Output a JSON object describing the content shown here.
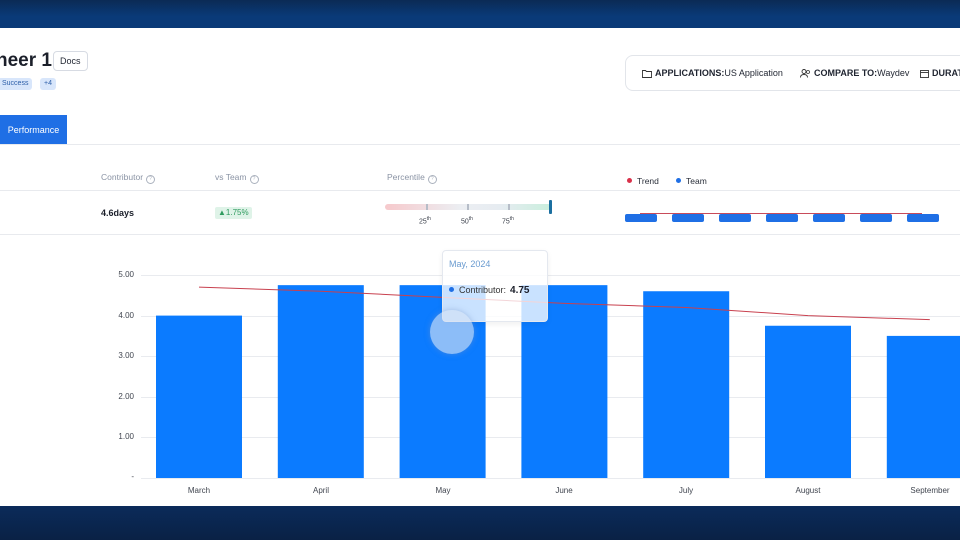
{
  "header": {
    "title": "neer 1",
    "docs_label": "Docs",
    "tags": [
      "Success",
      "+4"
    ]
  },
  "filters": {
    "applications_label": "APPLICATIONS:",
    "applications_value": "US Application",
    "compare_label": "COMPARE TO:",
    "compare_value": "Waydev",
    "duration_label": "DURATI"
  },
  "tabs": {
    "active": "Performance"
  },
  "metrics_table": {
    "headers": {
      "contributor": "Contributor",
      "vs_team": "vs Team",
      "percentile": "Percentile"
    },
    "legend": {
      "trend": "Trend",
      "team": "Team"
    },
    "row": {
      "contributor_value": "4.6days",
      "vs_team": "▲1.75%"
    },
    "percentile_ticks": [
      {
        "n": "25",
        "sup": "th"
      },
      {
        "n": "50",
        "sup": "th"
      },
      {
        "n": "75",
        "sup": "th"
      }
    ]
  },
  "tooltip": {
    "title": "May, 2024",
    "series": "Contributor:",
    "value": "4.75"
  },
  "colors": {
    "bar": "#0b7bff",
    "trend": "#c8414f",
    "accent": "#1f6fe5"
  },
  "chart_data": {
    "type": "bar",
    "categories": [
      "March",
      "April",
      "May",
      "June",
      "July",
      "August",
      "September"
    ],
    "series": [
      {
        "name": "Contributor",
        "values": [
          4.0,
          4.75,
          4.75,
          4.75,
          4.6,
          3.75,
          3.5
        ]
      },
      {
        "name": "Trend",
        "values": [
          4.7,
          4.6,
          4.45,
          4.3,
          4.2,
          4.0,
          3.9
        ]
      }
    ],
    "y_ticks": [
      "5.00",
      "4.00",
      "3.00",
      "2.00",
      "1.00",
      "-"
    ],
    "ylim": [
      0,
      5
    ],
    "grid": true
  }
}
